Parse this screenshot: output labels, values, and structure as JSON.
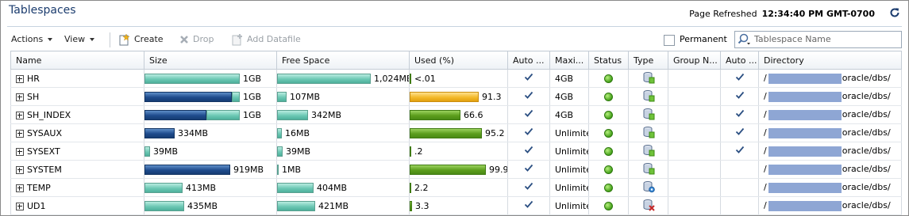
{
  "header": {
    "title": "Tablespaces",
    "refresh_label": "Page Refreshed",
    "refresh_time": "12:34:40 PM GMT-0700"
  },
  "toolbar": {
    "actions_label": "Actions",
    "view_label": "View",
    "create_label": "Create",
    "drop_label": "Drop",
    "add_datafile_label": "Add Datafile",
    "permanent_label": "Permanent",
    "permanent_checked": false,
    "search_placeholder": "Tablespace Name"
  },
  "columns": {
    "name": "Name",
    "size": "Size",
    "free_space": "Free Space",
    "used": "Used (%)",
    "auto1": "Auto ...",
    "maxi": "Maxi...",
    "status": "Status",
    "type": "Type",
    "group": "Group N...",
    "auto2": "Auto ...",
    "directory": "Directory"
  },
  "colors": {
    "title": "#1b3c6e",
    "teal_bar": "#6cc8b4",
    "navy_bar": "#1e4b8c",
    "orange_bar": "#f3b92a",
    "green_bar": "#5c9e1d",
    "status_online": "#45a11a",
    "masked_path": "#8ea6d4"
  },
  "rows": [
    {
      "name": "HR",
      "size": "1GB",
      "size_fill": 0.0,
      "size_color": "teal",
      "size_frac": 1.0,
      "free": "1,024MB",
      "free_frac": 1.0,
      "used": "<.01",
      "used_frac": 0.0,
      "used_color": "green",
      "auto1": true,
      "maxi": "4GB",
      "status": "online",
      "type_icon": "permanent-tablespace-icon",
      "auto2": true,
      "dir_prefix": "/",
      "dir_suffix": "oracle/dbs/"
    },
    {
      "name": "SH",
      "size": "1GB",
      "size_fill": 0.92,
      "size_color": "navy",
      "size_frac": 1.0,
      "free": "107MB",
      "free_frac": 0.1,
      "used": "91.3",
      "used_frac": 0.91,
      "used_color": "orange",
      "auto1": true,
      "maxi": "4GB",
      "status": "online",
      "type_icon": "permanent-tablespace-icon",
      "auto2": true,
      "dir_prefix": "/",
      "dir_suffix": "oracle/dbs/"
    },
    {
      "name": "SH_INDEX",
      "size": "1GB",
      "size_fill": 0.65,
      "size_color": "navy",
      "size_frac": 1.0,
      "free": "342MB",
      "free_frac": 0.33,
      "used": "66.6",
      "used_frac": 0.67,
      "used_color": "green",
      "auto1": true,
      "maxi": "4GB",
      "status": "online",
      "type_icon": "permanent-tablespace-icon",
      "auto2": true,
      "dir_prefix": "/",
      "dir_suffix": "oracle/dbs/"
    },
    {
      "name": "SYSAUX",
      "size": "334MB",
      "size_fill": 0.95,
      "size_color": "navy",
      "size_frac": 0.33,
      "free": "16MB",
      "free_frac": 0.05,
      "used": "95.2",
      "used_frac": 0.95,
      "used_color": "green",
      "auto1": true,
      "maxi": "Unlimited",
      "status": "online",
      "type_icon": "permanent-tablespace-icon",
      "auto2": true,
      "dir_prefix": "/",
      "dir_suffix": "oracle/dbs/"
    },
    {
      "name": "SYSEXT",
      "size": "39MB",
      "size_fill": 0.0,
      "size_color": "teal",
      "size_frac": 0.06,
      "free": "39MB",
      "free_frac": 0.06,
      "used": ".2",
      "used_frac": 0.0,
      "used_color": "green",
      "auto1": true,
      "maxi": "Unlimited",
      "status": "online",
      "type_icon": "permanent-tablespace-icon",
      "auto2": true,
      "dir_prefix": "/",
      "dir_suffix": "oracle/dbs/"
    },
    {
      "name": "SYSTEM",
      "size": "919MB",
      "size_fill": 1.0,
      "size_color": "navy",
      "size_frac": 0.9,
      "free": "1MB",
      "free_frac": 0.0,
      "used": "99.9",
      "used_frac": 1.0,
      "used_color": "green",
      "auto1": true,
      "maxi": "Unlimited",
      "status": "online",
      "type_icon": "permanent-tablespace-icon",
      "auto2": false,
      "dir_prefix": "/",
      "dir_suffix": "oracle/dbs/"
    },
    {
      "name": "TEMP",
      "size": "413MB",
      "size_fill": 0.0,
      "size_color": "teal",
      "size_frac": 0.4,
      "free": "404MB",
      "free_frac": 0.39,
      "used": "2.2",
      "used_frac": 0.02,
      "used_color": "green",
      "auto1": true,
      "maxi": "Unlimited",
      "status": "online",
      "type_icon": "temporary-tablespace-icon",
      "auto2": false,
      "dir_prefix": "/",
      "dir_suffix": "oracle/dbs/"
    },
    {
      "name": "UD1",
      "size": "435MB",
      "size_fill": 0.0,
      "size_color": "teal",
      "size_frac": 0.42,
      "free": "421MB",
      "free_frac": 0.41,
      "used": "3.3",
      "used_frac": 0.03,
      "used_color": "green",
      "auto1": true,
      "maxi": "Unlimited",
      "status": "online",
      "type_icon": "undo-tablespace-icon",
      "auto2": false,
      "dir_prefix": "/",
      "dir_suffix": "oracle/dbs/"
    }
  ]
}
